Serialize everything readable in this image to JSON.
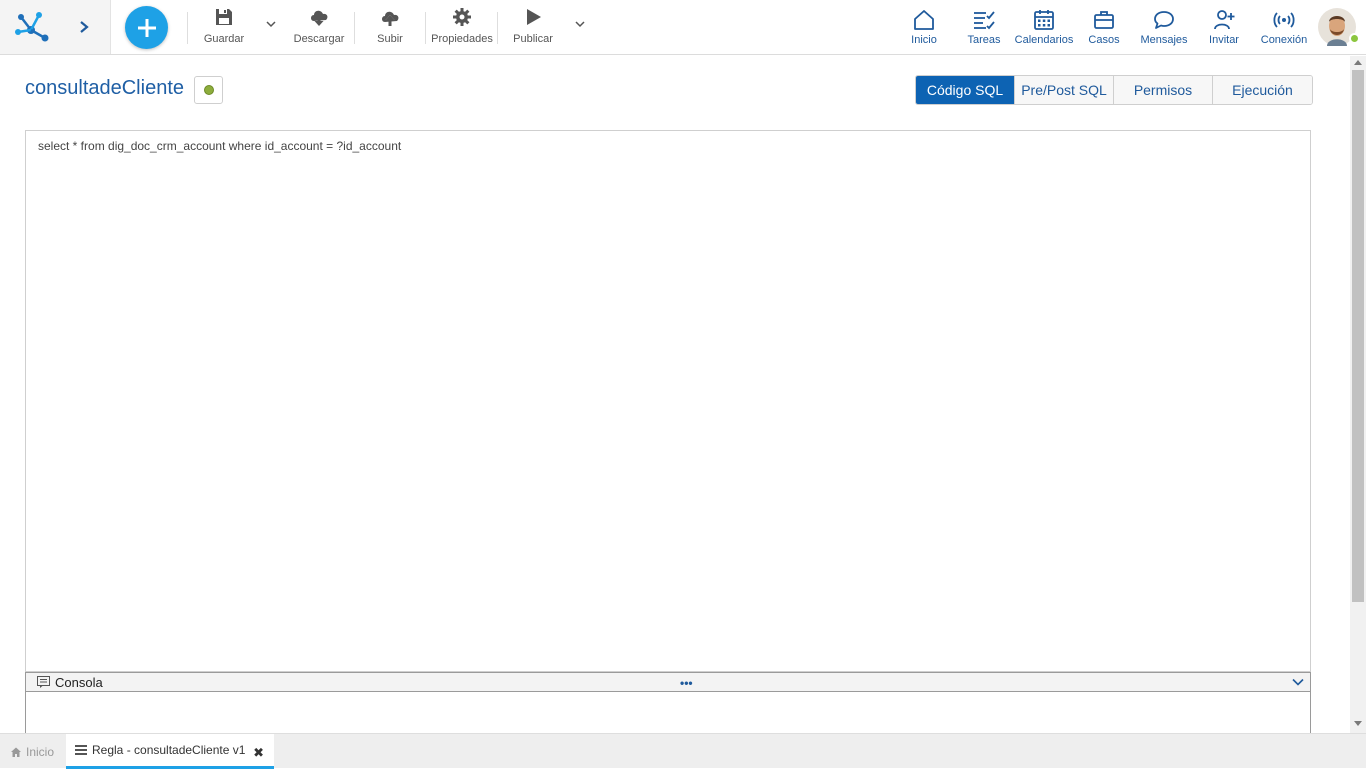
{
  "toolbar": {
    "save_label": "Guardar",
    "download_label": "Descargar",
    "upload_label": "Subir",
    "properties_label": "Propiedades",
    "publish_label": "Publicar"
  },
  "nav": {
    "home": "Inicio",
    "tasks": "Tareas",
    "calendars": "Calendarios",
    "cases": "Casos",
    "messages": "Mensajes",
    "invite": "Invitar",
    "connection": "Conexión"
  },
  "document": {
    "title": "consultadeCliente",
    "state_color": "#8dad3c"
  },
  "tabs": [
    {
      "label": "Código SQL",
      "active": true
    },
    {
      "label": "Pre/Post SQL",
      "active": false
    },
    {
      "label": "Permisos",
      "active": false
    },
    {
      "label": "Ejecución",
      "active": false
    }
  ],
  "editor": {
    "code": "select * from dig_doc_crm_account where id_account = ?id_account"
  },
  "console": {
    "label": "Consola",
    "handle": "•••"
  },
  "bottom_tabs": {
    "home": "Inicio",
    "document": "Regla - consultadeCliente v1",
    "close": "✖"
  },
  "colors": {
    "accent": "#1ea1e6",
    "active_tab": "#0d63b3",
    "nav_blue": "#1f5a9c"
  }
}
